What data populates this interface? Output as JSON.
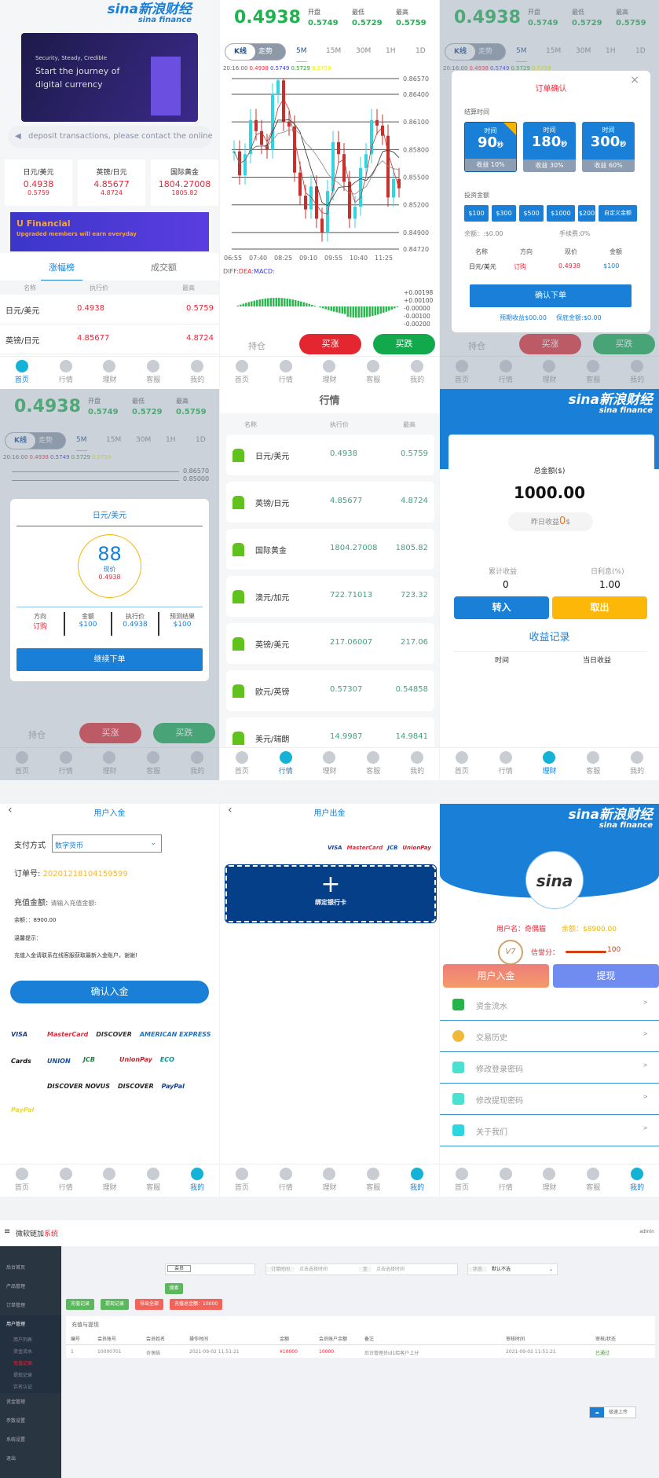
{
  "nav": [
    "首页",
    "行情",
    "理财",
    "客服",
    "我的"
  ],
  "logo": {
    "cn": "sina新浪财经",
    "en": "sina finance"
  },
  "home": {
    "banner": {
      "l1": "Security, Steady, Credible",
      "l2": "Start the journey of",
      "l3": "digital currency"
    },
    "notice": "deposit transactions, please contact the online",
    "cards": [
      {
        "name": "日元/美元",
        "price": "0.4938",
        "high": "0.5759"
      },
      {
        "name": "英镑/日元",
        "price": "4.85677",
        "high": "4.8724"
      },
      {
        "name": "国际黄金",
        "price": "1804.27008",
        "high": "1805.82"
      }
    ],
    "banner2": {
      "title": "U Financial",
      "sub": "Upgraded members will earn everyday"
    },
    "tabs": [
      "涨幅榜",
      "成交额"
    ],
    "cols": [
      "名称",
      "执行价",
      "最高"
    ],
    "rows": [
      [
        "日元/美元",
        "0.4938",
        "0.5759"
      ],
      [
        "英镑/日元",
        "4.85677",
        "4.8724"
      ]
    ]
  },
  "trade": {
    "price": "0.4938",
    "open_label": "开盘",
    "open": "0.5749",
    "low_label": "最低",
    "low": "0.5729",
    "high_label": "最高",
    "high": "0.5759",
    "modes": [
      "K线",
      "走势"
    ],
    "periods": [
      "5M",
      "15M",
      "30M",
      "1H",
      "1D"
    ],
    "info": {
      "time": "20:16:00",
      "v1": "0.4938",
      "v2": "0.5749",
      "v3": "0.5729",
      "v4": "0.5759"
    },
    "yticks": [
      "0.86570",
      "0.86400",
      "0.86100",
      "0.85800",
      "0.85500",
      "0.85200",
      "0.84900",
      "0.84720"
    ],
    "xticks": [
      "06:55",
      "07:40",
      "08:25",
      "09:10",
      "09:55",
      "10:40",
      "11:25"
    ],
    "macd_label": {
      "diff": "DIFF:",
      "dea": "DEA:",
      "macd": "MACD:"
    },
    "macd_ticks": [
      "+0.00198",
      "+0.00100",
      "-0.00000",
      "-0.00100",
      "-0.00200"
    ],
    "hold": "持仓",
    "buy_up": "买涨",
    "buy_down": "买跌",
    "closes": [
      0.8578,
      0.8552,
      0.8575,
      0.8612,
      0.86,
      0.8585,
      0.858,
      0.864,
      0.8655,
      0.861,
      0.8605,
      0.8555,
      0.853,
      0.8515,
      0.854,
      0.8505,
      0.849,
      0.8535,
      0.8588,
      0.8575,
      0.8545,
      0.8505,
      0.8518,
      0.856,
      0.8575,
      0.8612,
      0.8606,
      0.8595,
      0.8528,
      0.8548,
      0.8538
    ]
  },
  "order_modal": {
    "title": "订单确认",
    "settle_label": "结算时间",
    "times": [
      {
        "label": "时间",
        "value": "90",
        "unit": "秒",
        "profit": "收益 10%"
      },
      {
        "label": "时间",
        "value": "180",
        "unit": "秒",
        "profit": "收益 30%"
      },
      {
        "label": "时间",
        "value": "300",
        "unit": "秒",
        "profit": "收益 60%"
      }
    ],
    "amount_label": "投资金额",
    "amounts": [
      "$100",
      "$300",
      "$500",
      "$1000",
      "$200",
      "自定义金额"
    ],
    "balance": "余额：:$0.00",
    "fee": "手续费:0%",
    "cols": [
      "名称",
      "方向",
      "现价",
      "金额"
    ],
    "row": [
      "日元/美元",
      "订购",
      "0.4938",
      "$100"
    ],
    "confirm": "确认下单",
    "expected": "预期收益$00.00",
    "guarantee": "保底金额:$0.00"
  },
  "result_modal": {
    "title": "日元/美元",
    "countdown": "88",
    "now_label": "现价",
    "now": "0.4938",
    "cols": [
      {
        "k": "方向",
        "v": "订购"
      },
      {
        "k": "金额",
        "v": "$100"
      },
      {
        "k": "执行价",
        "v": "0.4938"
      },
      {
        "k": "预测结果",
        "v": "$100"
      }
    ],
    "continue": "继续下单",
    "yticks": [
      "0.86570",
      "0.85000"
    ]
  },
  "market": {
    "title": "行情",
    "cols": [
      "名称",
      "执行价",
      "最高"
    ],
    "rows": [
      [
        "日元/美元",
        "0.4938",
        "0.5759"
      ],
      [
        "英镑/日元",
        "4.85677",
        "4.8724"
      ],
      [
        "国际黄金",
        "1804.27008",
        "1805.82"
      ],
      [
        "澳元/加元",
        "722.71013",
        "723.32"
      ],
      [
        "英镑/美元",
        "217.06007",
        "217.06"
      ],
      [
        "欧元/英镑",
        "0.57307",
        "0.54858"
      ],
      [
        "美元/瑞朗",
        "14.9987",
        "14.9841"
      ]
    ]
  },
  "finance": {
    "total_label": "总金额($)",
    "total": "1000.00",
    "yesterday_label": "昨日收益",
    "yesterday": "0",
    "yesterday_unit": "$",
    "cum_label": "累计收益",
    "cum": "0",
    "rate_label": "日利息(%)",
    "rate": "1.00",
    "in": "转入",
    "out": "取出",
    "record": "收益记录",
    "cols": [
      "时间",
      "当日收益"
    ]
  },
  "deposit": {
    "title": "用户入金",
    "pay_label": "支付方式",
    "pay_value": "数字货币",
    "order_label": "订单号:",
    "order_no": "20201218104159599",
    "amount_label": "充值金额:",
    "amount_placeholder": "请输入充值金额:",
    "balance": "余额：：8900.00",
    "tip_label": "温馨提示：",
    "tip": "充值入金请联系在线客服获取最新入金账户，谢谢!",
    "confirm": "确认入金",
    "logos": [
      "VISA",
      "MasterCard",
      "DISCOVER",
      "AMERICAN EXPRESS",
      "Cards",
      "UNION",
      "JCB",
      "UnionPay",
      "ECO",
      "",
      "DISCOVER NOVUS",
      "DISCOVER",
      "PayPal",
      "PayPal"
    ]
  },
  "withdraw": {
    "title": "用户出金",
    "logos": [
      "VISA",
      "MasterCard",
      "JCB",
      "UnionPay"
    ],
    "bind": "绑定银行卡"
  },
  "mine": {
    "user_label": "用户名：",
    "user": "奇偶猫",
    "bal_label": "余额：",
    "bal": "$8900.00",
    "level": "V7",
    "credit_label": "信誉分：",
    "credit": "100",
    "deposit": "用户入金",
    "withdraw": "提现",
    "menu": [
      "资金流水",
      "交易历史",
      "修改登录密码",
      "修改提现密码",
      "关于我们"
    ]
  },
  "admin": {
    "title": "微软链加",
    "title_red": "系统",
    "user": "admin",
    "menu": [
      "后台首页",
      "产品管理",
      "订单管理",
      "用户管理",
      "用户列表",
      "资金流水",
      "充值记录",
      "提现记录",
      "实名认证",
      "资金管理",
      "参数设置",
      "系统设置",
      "退出"
    ],
    "search": {
      "select": "会员",
      "time_label": "订单时间",
      "from": "点击选择时间",
      "to_label": "至",
      "to": "点击选择时间",
      "status_label": "状态",
      "status": "默认不选",
      "btn": "搜索"
    },
    "buttons": [
      "充值记录",
      "提现记录",
      "导出全部",
      "充值总金额：10000"
    ],
    "table_title": "充值与提现",
    "cols": [
      "编号",
      "会员账号",
      "会员姓名",
      "操作时间",
      "金额",
      "会员账户余额",
      "备注",
      "审核时间",
      "审核/状态"
    ],
    "row": [
      "1",
      "10000701",
      "奇偶猫",
      "2021-09-02 11:51:21",
      "¥10000",
      "10000",
      "后台管理员id1给客户上分",
      "2021-09-02 11:51:21",
      "已通过"
    ],
    "upload": "极速上传"
  },
  "colors": {
    "blue": "#1a7fd6",
    "red": "#e8293a",
    "green": "#1fb24f",
    "gold": "#f5b400"
  }
}
